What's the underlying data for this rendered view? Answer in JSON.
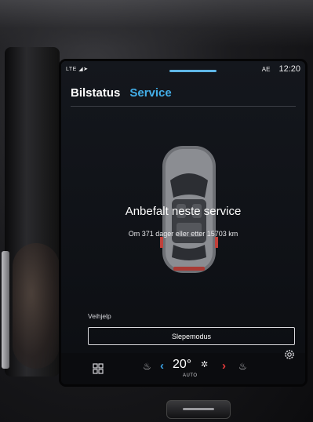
{
  "status_bar": {
    "signal": "LTE",
    "ae": "AE",
    "time": "12:20"
  },
  "tabs": [
    {
      "label": "Bilstatus",
      "active": false
    },
    {
      "label": "Service",
      "active": true
    }
  ],
  "service": {
    "headline": "Anbefalt neste service",
    "detail": "Om 371 dager eller etter 15703 km"
  },
  "assist": {
    "section_label": "Veihjelp",
    "button_label": "Slepemodus"
  },
  "climate": {
    "temperature": "20°",
    "mode": "AUTO",
    "icons": [
      "apps-grid-icon",
      "seat-heat-left-icon",
      "fan-icon",
      "seat-heat-right-icon",
      "settings-gear-icon"
    ]
  },
  "colors": {
    "accent": "#43aee8",
    "temp_down": "#3aa2e6",
    "temp_up": "#ea3b3b"
  }
}
